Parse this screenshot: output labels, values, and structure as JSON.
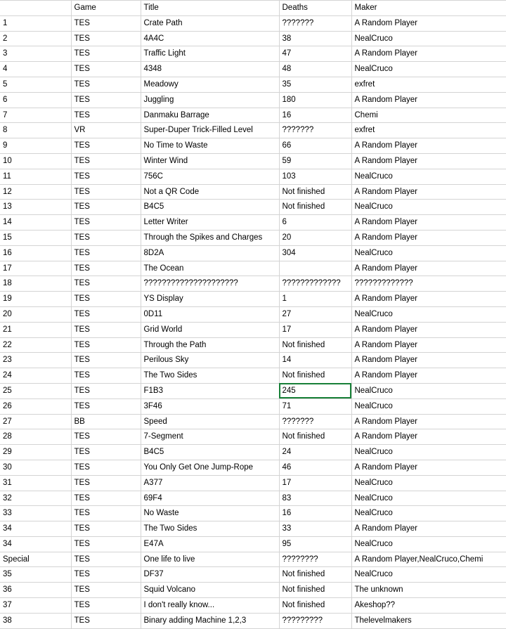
{
  "table": {
    "columns": [
      "",
      "Game",
      "Title",
      "Deaths",
      "Maker"
    ],
    "selected_cell": {
      "row": 25,
      "column": "Deaths",
      "value": "245"
    },
    "selection_color": "#188038",
    "gridline_color": "#d4d4d4",
    "rows": [
      {
        "index": "1",
        "game": "TES",
        "title": "Crate Path",
        "deaths": "???????",
        "maker": "A Random Player"
      },
      {
        "index": "2",
        "game": "TES",
        "title": "4A4C",
        "deaths": "38",
        "maker": "NealCruco"
      },
      {
        "index": "3",
        "game": "TES",
        "title": "Traffic Light",
        "deaths": "47",
        "maker": "A Random Player"
      },
      {
        "index": "4",
        "game": "TES",
        "title": "4348",
        "deaths": "48",
        "maker": "NealCruco"
      },
      {
        "index": "5",
        "game": "TES",
        "title": "Meadowy",
        "deaths": "35",
        "maker": "exfret"
      },
      {
        "index": "6",
        "game": "TES",
        "title": "Juggling",
        "deaths": "180",
        "maker": "A Random Player"
      },
      {
        "index": "7",
        "game": "TES",
        "title": "Danmaku Barrage",
        "deaths": "16",
        "maker": "Chemi"
      },
      {
        "index": "8",
        "game": "VR",
        "title": "Super-Duper Trick-Filled Level",
        "deaths": "???????",
        "maker": "exfret"
      },
      {
        "index": "9",
        "game": "TES",
        "title": "No Time to Waste",
        "deaths": "66",
        "maker": "A Random Player"
      },
      {
        "index": "10",
        "game": "TES",
        "title": "Winter Wind",
        "deaths": "59",
        "maker": "A Random Player"
      },
      {
        "index": "11",
        "game": "TES",
        "title": "756C",
        "deaths": "103",
        "maker": "NealCruco"
      },
      {
        "index": "12",
        "game": "TES",
        "title": "Not a QR Code",
        "deaths": "Not finished",
        "maker": "A Random Player"
      },
      {
        "index": "13",
        "game": "TES",
        "title": "B4C5",
        "deaths": "Not finished",
        "maker": "NealCruco"
      },
      {
        "index": "14",
        "game": "TES",
        "title": "Letter Writer",
        "deaths": "6",
        "maker": "A Random Player"
      },
      {
        "index": "15",
        "game": "TES",
        "title": "Through the Spikes and Charges",
        "deaths": "20",
        "maker": "A Random Player"
      },
      {
        "index": "16",
        "game": "TES",
        "title": "8D2A",
        "deaths": "304",
        "maker": "NealCruco"
      },
      {
        "index": "17",
        "game": "TES",
        "title": "The Ocean",
        "deaths": "",
        "maker": "A Random Player"
      },
      {
        "index": "18",
        "game": "TES",
        "title": "?????????????????????",
        "deaths": "?????????????",
        "maker": "?????????????"
      },
      {
        "index": "19",
        "game": "TES",
        "title": "YS Display",
        "deaths": "1",
        "maker": "A Random Player"
      },
      {
        "index": "20",
        "game": "TES",
        "title": "0D11",
        "deaths": "27",
        "maker": "NealCruco"
      },
      {
        "index": "21",
        "game": "TES",
        "title": "Grid World",
        "deaths": "17",
        "maker": "A Random Player"
      },
      {
        "index": "22",
        "game": "TES",
        "title": "Through the Path",
        "deaths": "Not finished",
        "maker": "A Random Player"
      },
      {
        "index": "23",
        "game": "TES",
        "title": "Perilous Sky",
        "deaths": "14",
        "maker": "A Random Player"
      },
      {
        "index": "24",
        "game": "TES",
        "title": "The Two Sides",
        "deaths": "Not finished",
        "maker": "A Random Player"
      },
      {
        "index": "25",
        "game": "TES",
        "title": "F1B3",
        "deaths": "245",
        "maker": "NealCruco"
      },
      {
        "index": "26",
        "game": "TES",
        "title": "3F46",
        "deaths": "71",
        "maker": "NealCruco"
      },
      {
        "index": "27",
        "game": "BB",
        "title": "Speed",
        "deaths": "???????",
        "maker": "A Random Player"
      },
      {
        "index": "28",
        "game": "TES",
        "title": "7-Segment",
        "deaths": "Not finished",
        "maker": "A Random Player"
      },
      {
        "index": "29",
        "game": "TES",
        "title": "B4C5",
        "deaths": "24",
        "maker": "NealCruco"
      },
      {
        "index": "30",
        "game": "TES",
        "title": "You Only Get One Jump-Rope",
        "deaths": "46",
        "maker": "A Random Player"
      },
      {
        "index": "31",
        "game": "TES",
        "title": "A377",
        "deaths": "17",
        "maker": "NealCruco"
      },
      {
        "index": "32",
        "game": "TES",
        "title": "69F4",
        "deaths": "83",
        "maker": "NealCruco"
      },
      {
        "index": "33",
        "game": "TES",
        "title": "No Waste",
        "deaths": "16",
        "maker": "NealCruco"
      },
      {
        "index": "34",
        "game": "TES",
        "title": "The Two Sides",
        "deaths": "33",
        "maker": "A Random Player"
      },
      {
        "index": "34",
        "game": "TES",
        "title": "E47A",
        "deaths": "95",
        "maker": "NealCruco"
      },
      {
        "index": "Special",
        "game": "TES",
        "title": "One life to live",
        "deaths": "????????",
        "maker": "A Random Player,NealCruco,Chemi"
      },
      {
        "index": "35",
        "game": "TES",
        "title": "DF37",
        "deaths": "Not finished",
        "maker": "NealCruco"
      },
      {
        "index": "36",
        "game": "TES",
        "title": "Squid Volcano",
        "deaths": "Not finished",
        "maker": "The unknown"
      },
      {
        "index": "37",
        "game": "TES",
        "title": "I don't really know...",
        "deaths": "Not finished",
        "maker": "Akeshop??"
      },
      {
        "index": "38",
        "game": "TES",
        "title": "Binary adding Machine 1,2,3",
        "deaths": "?????????",
        "maker": "Thelevelmakers"
      }
    ]
  }
}
